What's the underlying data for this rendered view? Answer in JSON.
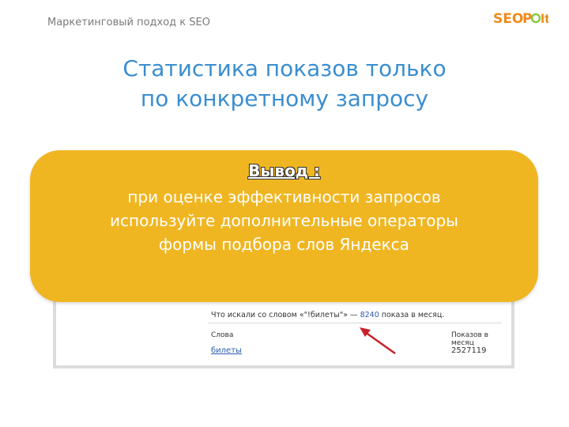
{
  "header": {
    "subtitle": "Маркетинговый подход к SEO",
    "logo_text": "SEOPult"
  },
  "title": {
    "line1": "Статистика показов только",
    "line2": "по конкретному запросу"
  },
  "callout": {
    "heading": "Вывод :",
    "line1": "при оценке эффективности запросов",
    "line2": "используйте дополнительные операторы",
    "line3": "формы подбора слов Яндекса"
  },
  "screenshot": {
    "query_prefix": "Что искали со словом «\"!билеты\"» — ",
    "query_count": "8240",
    "query_suffix": " показа в месяц.",
    "col_words": "Слова",
    "col_shows": "Показов в месяц",
    "row_word": "билеты",
    "row_value": "2527119"
  },
  "colors": {
    "title": "#3a8ed0",
    "callout_bg": "#f0b622",
    "arrow": "#c8202a",
    "logo_orange": "#f08a1c",
    "logo_green": "#8cc63f"
  }
}
